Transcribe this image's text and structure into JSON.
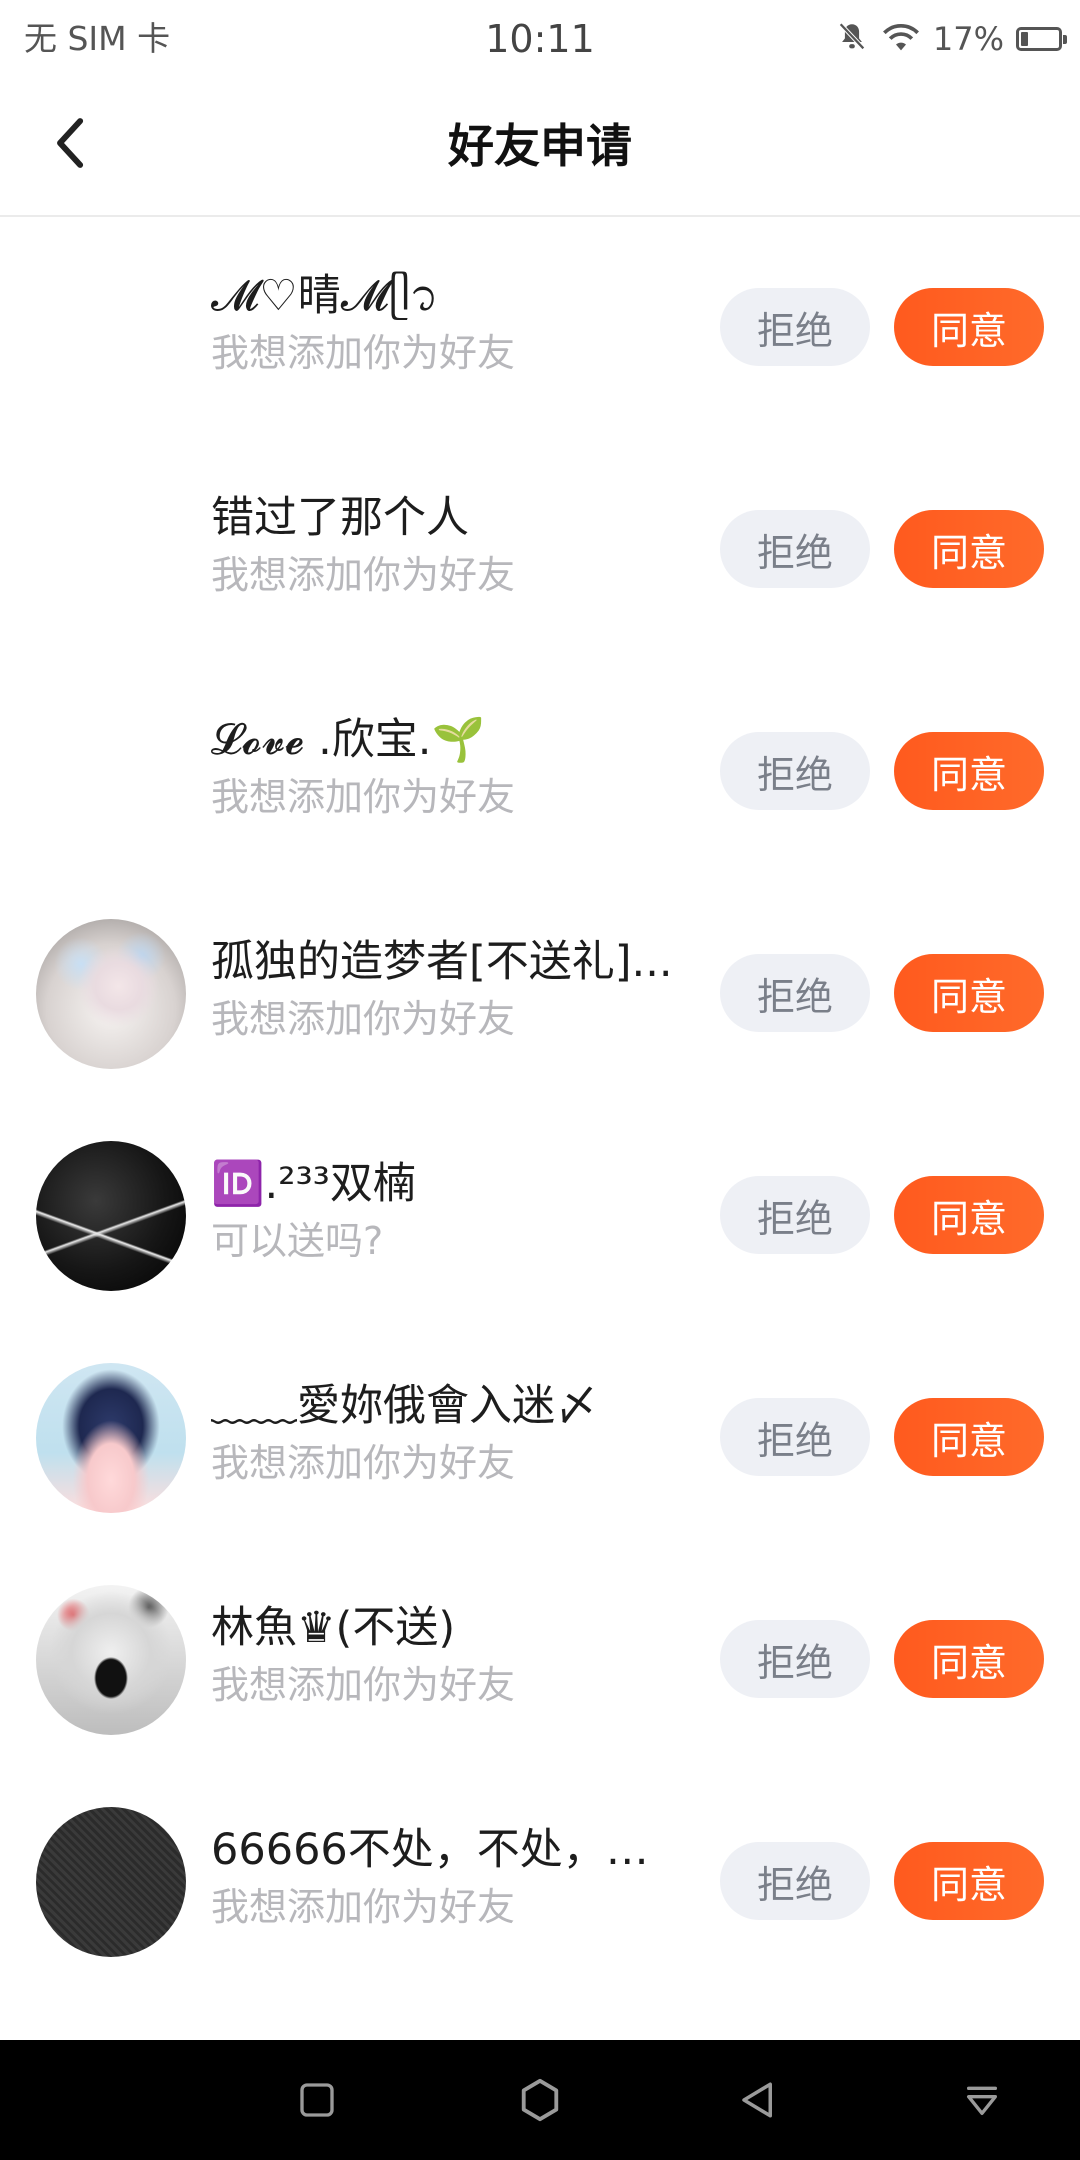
{
  "status_bar": {
    "carrier": "无 SIM 卡",
    "time": "10:11",
    "battery": "17%",
    "icons": [
      "bell-off-icon",
      "wifi-icon",
      "battery-icon"
    ]
  },
  "header": {
    "title": "好友申请",
    "back_icon": "chevron-left-icon"
  },
  "buttons": {
    "reject": "拒绝",
    "accept": "同意"
  },
  "colors": {
    "accent": "#ff5a1e",
    "reject_bg": "#eef0f5",
    "subtext": "#b7b7bb"
  },
  "requests": [
    {
      "name": "𝓜♡晴𝓜ᥫ᭡",
      "message": "我想添加你为好友",
      "has_avatar": false
    },
    {
      "name": "错过了那个人",
      "message": "我想添加你为好友",
      "has_avatar": false
    },
    {
      "name": "𝓛𝓸𝓿𝓮 .欣宝.🌱",
      "message": "我想添加你为好友",
      "has_avatar": false
    },
    {
      "name": "孤独的造梦者[不送礼]...",
      "message": "我想添加你为好友",
      "has_avatar": true
    },
    {
      "name": "🆔.²³³双楠",
      "message": "可以送吗?",
      "has_avatar": true
    },
    {
      "name": "﹏﹏愛妳俄會入迷〆",
      "message": "我想添加你为好友",
      "has_avatar": true
    },
    {
      "name": "林魚♛(不送)",
      "message": "我想添加你为好友",
      "has_avatar": true
    },
    {
      "name": "66666不处，不处，处...",
      "message": "我想添加你为好友",
      "has_avatar": true
    }
  ],
  "nav_bar": {
    "icons": [
      "square-icon",
      "hexagon-home-icon",
      "triangle-back-icon",
      "notification-pull-icon"
    ]
  }
}
